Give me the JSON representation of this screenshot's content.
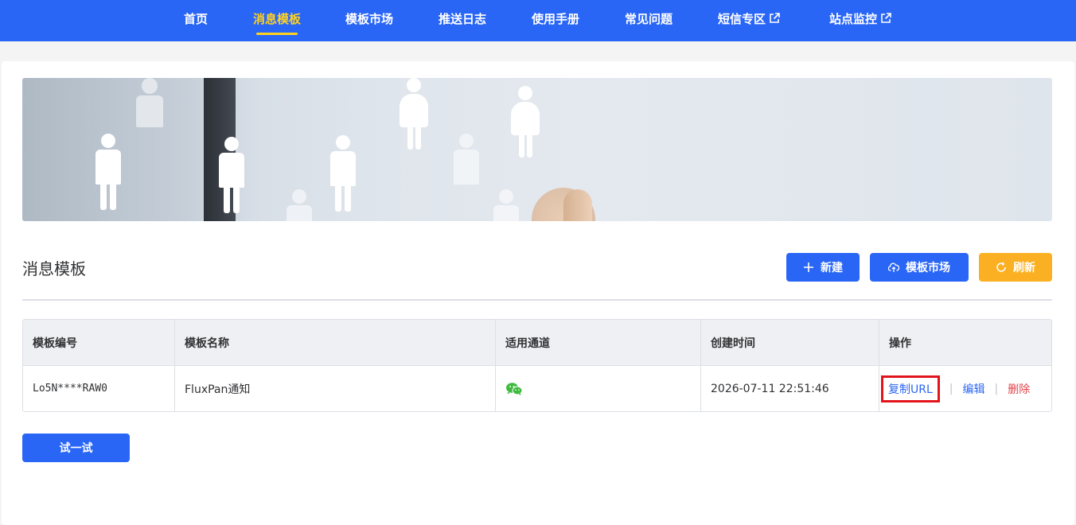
{
  "nav": {
    "items": [
      {
        "label": "首页"
      },
      {
        "label": "消息模板",
        "active": true
      },
      {
        "label": "模板市场"
      },
      {
        "label": "推送日志"
      },
      {
        "label": "使用手册"
      },
      {
        "label": "常见问题"
      },
      {
        "label": "短信专区",
        "external": true
      },
      {
        "label": "站点监控",
        "external": true
      }
    ]
  },
  "section": {
    "title": "消息模板",
    "buttons": {
      "new_label": "新建",
      "market_label": "模板市场",
      "refresh_label": "刷新"
    }
  },
  "table": {
    "headers": [
      "模板编号",
      "模板名称",
      "适用通道",
      "创建时间",
      "操作"
    ],
    "rows": [
      {
        "id": "Lo5N****RAW0",
        "name": "FluxPan通知",
        "channel_icon": "wechat-icon",
        "created": "2026-07-11 22:51:46",
        "actions": {
          "copy": "复制URL",
          "edit": "编辑",
          "delete": "删除"
        }
      }
    ]
  },
  "try_button": "试一试",
  "colors": {
    "primary": "#2a66f6",
    "active_nav": "#ffd21f",
    "warning": "#fbb023",
    "danger": "#e0444a",
    "highlight_box": "#e1141b",
    "wechat": "#3fba3f"
  }
}
